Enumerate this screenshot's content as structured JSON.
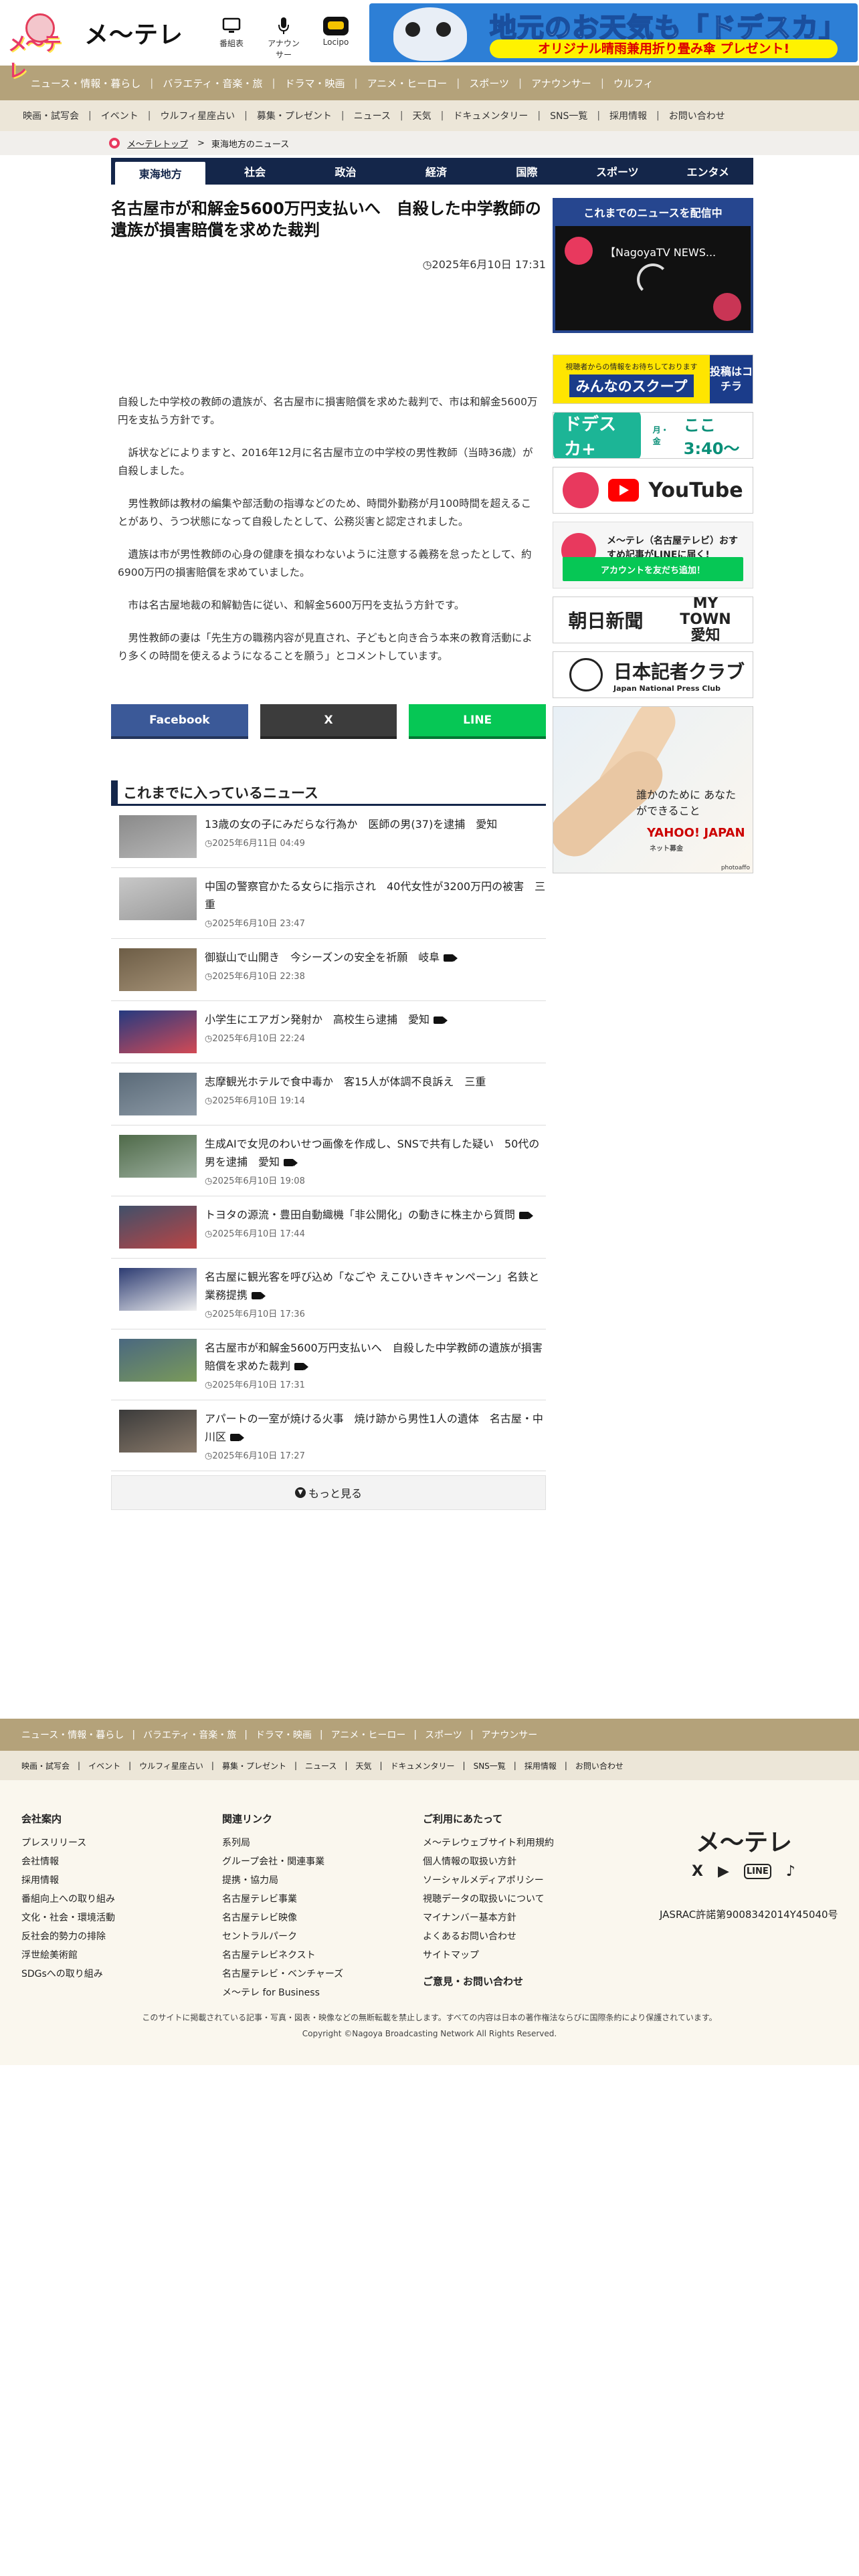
{
  "header": {
    "mascot_text": "メ〜テレ",
    "logo": "メ〜テレ",
    "icons": [
      {
        "name": "tv-icon",
        "label": "番組表"
      },
      {
        "name": "mic-icon",
        "label": "アナウンサー"
      },
      {
        "name": "locipo-icon",
        "label": "Locipo"
      }
    ],
    "ad": {
      "line1": "地元のお天気も「ドデスカ」",
      "line2": "オリジナル晴雨兼用折り畳み傘 プレゼント!"
    }
  },
  "nav_primary": [
    "ニュース・情報・暮らし",
    "バラエティ・音楽・旅",
    "ドラマ・映画",
    "アニメ・ヒーロー",
    "スポーツ",
    "アナウンサー",
    "ウルフィ"
  ],
  "nav_secondary": [
    "映画・試写会",
    "イベント",
    "ウルフィ星座占い",
    "募集・プレゼント",
    "ニュース",
    "天気",
    "ドキュメンタリー",
    "SNS一覧",
    "採用情報",
    "お問い合わせ"
  ],
  "breadcrumb": {
    "home": "メ〜テレトップ",
    "sep": ">",
    "current": "東海地方のニュース"
  },
  "region_tabs": [
    "東海地方",
    "社会",
    "政治",
    "経済",
    "国際",
    "スポーツ",
    "エンタメ"
  ],
  "article": {
    "title": "名古屋市が和解金5600万円支払いへ　自殺した中学教師の遺族が損害賠償を求めた裁判",
    "date": "2025年6月10日 17:31",
    "paragraphs": [
      "自殺した中学校の教師の遺族が、名古屋市に損害賠償を求めた裁判で、市は和解金5600万円を支払う方針です。",
      "訴状などによりますと、2016年12月に名古屋市立の中学校の男性教師（当時36歳）が自殺しました。",
      "男性教師は教材の編集や部活動の指導などのため、時間外勤務が月100時間を超えることがあり、うつ状態になって自殺したとして、公務災害と認定されました。",
      "遺族は市が男性教師の心身の健康を損なわないように注意する義務を怠ったとして、約6900万円の損害賠償を求めていました。",
      "市は名古屋地裁の和解勧告に従い、和解金5600万円を支払う方針です。",
      "男性教師の妻は「先生方の職務内容が見直され、子どもと向き合う本来の教育活動により多くの時間を使えるようになることを願う」とコメントしています。"
    ]
  },
  "share": {
    "facebook": "Facebook",
    "x": "X",
    "line": "LINE"
  },
  "news_heading": "これまでに入っているニュース",
  "news": [
    {
      "title": "13歳の女の子にみだらな行為か　医師の男(37)を逮捕　愛知",
      "time": "2025年6月11日 04:49",
      "video": false,
      "thumb": [
        "#8a8a8a",
        "#b8b8b8"
      ]
    },
    {
      "title": "中国の警察官かたる女らに指示され　40代女性が3200万円の被害　三重",
      "time": "2025年6月10日 23:47",
      "video": false,
      "thumb": [
        "#c8c8c8",
        "#999"
      ]
    },
    {
      "title": "御嶽山で山開き　今シーズンの安全を祈願　岐阜",
      "time": "2025年6月10日 22:38",
      "video": true,
      "thumb": [
        "#6d5d46",
        "#a59277"
      ]
    },
    {
      "title": "小学生にエアガン発射か　高校生ら逮捕　愛知",
      "time": "2025年6月10日 22:24",
      "video": true,
      "thumb": [
        "#253a80",
        "#d24a55"
      ]
    },
    {
      "title": "志摩観光ホテルで食中毒か　客15人が体調不良訴え　三重",
      "time": "2025年6月10日 19:14",
      "video": false,
      "thumb": [
        "#5a6a78",
        "#8d9aa6"
      ]
    },
    {
      "title": "生成AIで女児のわいせつ画像を作成し、SNSで共有した疑い　50代の男を逮捕　愛知",
      "time": "2025年6月10日 19:08",
      "video": true,
      "thumb": [
        "#4f6a49",
        "#9db0a0"
      ]
    },
    {
      "title": "トヨタの源流・豊田自動織機「非公開化」の動きに株主から質問",
      "time": "2025年6月10日 17:44",
      "video": true,
      "thumb": [
        "#40506a",
        "#b44"
      ]
    },
    {
      "title": "名古屋に観光客を呼び込め「なごや えこひいきキャンペーン」名鉄と業務提携",
      "time": "2025年6月10日 17:36",
      "video": true,
      "thumb": [
        "#2c3b72",
        "#f0f0f0"
      ]
    },
    {
      "title": "名古屋市が和解金5600万円支払いへ　自殺した中学教師の遺族が損害賠償を求めた裁判",
      "time": "2025年6月10日 17:31",
      "video": true,
      "thumb": [
        "#4a6880",
        "#7a9a5a"
      ]
    },
    {
      "title": "アパートの一室が焼ける火事　焼け跡から男性1人の遺体　名古屋・中川区",
      "time": "2025年6月10日 17:27",
      "video": true,
      "thumb": [
        "#3b3b3b",
        "#8a7a6a"
      ]
    }
  ],
  "more_label": "もっと見る",
  "sidebar": {
    "live_heading": "これまでのニュースを配信中",
    "live_title": "【NagoyaTV NEWS...",
    "scoop_small": "視聴者からの情報をお待ちしております",
    "scoop_big": "みんなのスクープ",
    "scoop_right": "投稿はコチラ",
    "dodesuka": "ドデスカ+",
    "dodesuka_time": "ここ3:40〜",
    "dodesuka_days": "月・金",
    "youtube": "YouTube",
    "line_text": "メ〜テレ（名古屋テレビ）おすすめ記事がLINEに届く!",
    "line_btn": "アカウントを友だち追加！",
    "asahi": "朝日新聞",
    "mytown": "MY TOWN 愛知",
    "press_jp": "日本記者クラブ",
    "press_en": "Japan National Press Club",
    "hands_text": "誰かのために あなたができること",
    "hands_brand": "YAHOO! JAPAN",
    "hands_brand_sub": "ネット募金",
    "hands_credit": "photoaffo"
  },
  "footer": {
    "nav1": [
      "ニュース・情報・暮らし",
      "バラエティ・音楽・旅",
      "ドラマ・映画",
      "アニメ・ヒーロー",
      "スポーツ",
      "アナウンサー"
    ],
    "nav2": [
      "映画・試写会",
      "イベント",
      "ウルフィ星座占い",
      "募集・プレゼント",
      "ニュース",
      "天気",
      "ドキュメンタリー",
      "SNS一覧",
      "採用情報",
      "お問い合わせ"
    ],
    "col1": {
      "h": "会社案内",
      "items": [
        "プレスリリース",
        "会社情報",
        "採用情報",
        "番組向上への取り組み",
        "文化・社会・環境活動",
        "反社会的勢力の排除",
        "浮世絵美術館",
        "SDGsへの取り組み"
      ]
    },
    "col2": {
      "h": "関連リンク",
      "items": [
        "系列局",
        "グループ会社・関連事業",
        "提携・協力局",
        "名古屋テレビ事業",
        "名古屋テレビ映像",
        "セントラルパーク",
        "名古屋テレビネクスト",
        "名古屋テレビ・ベンチャーズ",
        "メ〜テレ for Business"
      ]
    },
    "col3": {
      "h": "ご利用にあたって",
      "items": [
        "メ〜テレウェブサイト利用規約",
        "個人情報の取扱い方針",
        "ソーシャルメディアポリシー",
        "視聴データの取扱いについて",
        "マイナンバー基本方針",
        "よくあるお問い合わせ",
        "サイトマップ"
      ]
    },
    "contact": "ご意見・お問い合わせ",
    "logo": "メ〜テレ",
    "social": [
      "X",
      "▶",
      "LINE",
      "♪"
    ],
    "jasrac": "JASRAC許諾第9008342014Y45040号",
    "note1": "このサイトに掲載されている記事・写真・図表・映像などの無断転載を禁止します。すべての内容は日本の著作権法ならびに国際条約により保護されています。",
    "note2": "Copyright ©Nagoya Broadcasting Network All Rights Reserved."
  }
}
